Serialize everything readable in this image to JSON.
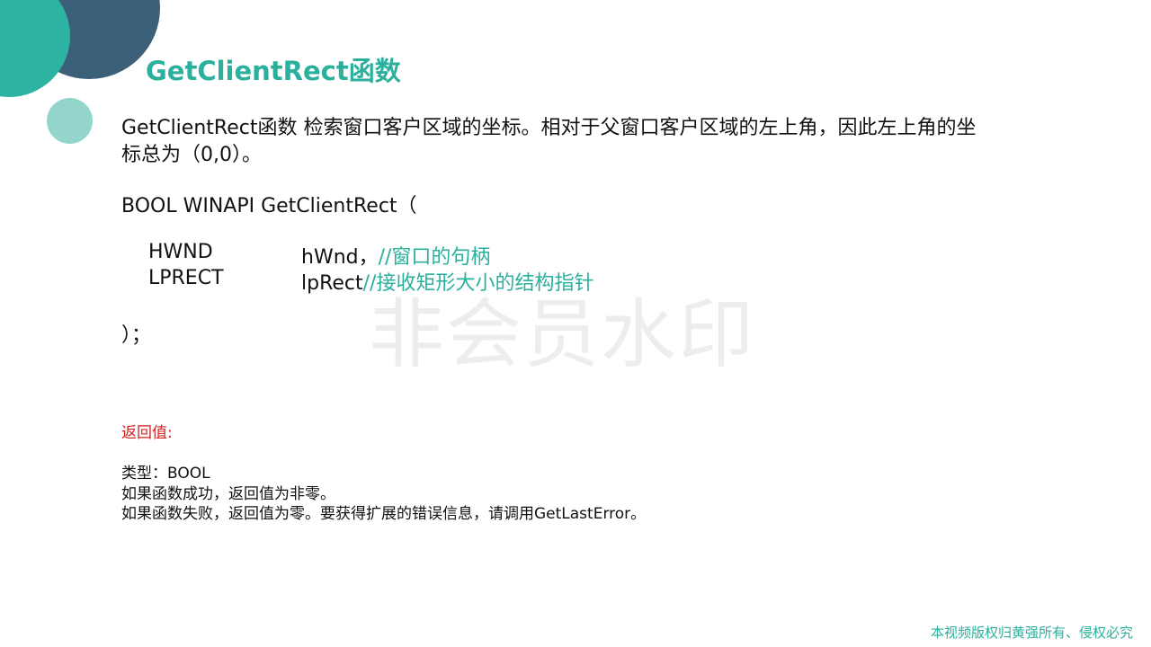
{
  "slide": {
    "title": "GetClientRect函数",
    "description": {
      "line1": "GetClientRect函数   检索窗口客户区域的坐标。相对于父窗口客户区域的左上角，因此左上角的坐",
      "line2": "标总为（0,0）。"
    },
    "code": {
      "signature": "BOOL WINAPI GetClientRect（",
      "params": [
        {
          "type": "HWND",
          "name": "hWnd，",
          "comment": "//窗口的句柄"
        },
        {
          "type": "LPRECT",
          "name": "lpRect",
          "comment": "//接收矩形大小的结构指针"
        }
      ],
      "closing": "）；"
    },
    "return": {
      "label": "返回值:",
      "type_line": "类型：BOOL",
      "success_line": "如果函数成功，返回值为非零。",
      "failure_line": "如果函数失败，返回值为零。要获得扩展的错误信息，请调用GetLastError。"
    },
    "watermark": "非会员水印",
    "copyright": "本视频版权归黄强所有、侵权必究"
  },
  "colors": {
    "accent": "#2ab09d",
    "return_label": "#d21f1f",
    "deco_dark": "#3d6079",
    "deco_teal": "#2cb3a1",
    "deco_light": "#93d4cb"
  }
}
